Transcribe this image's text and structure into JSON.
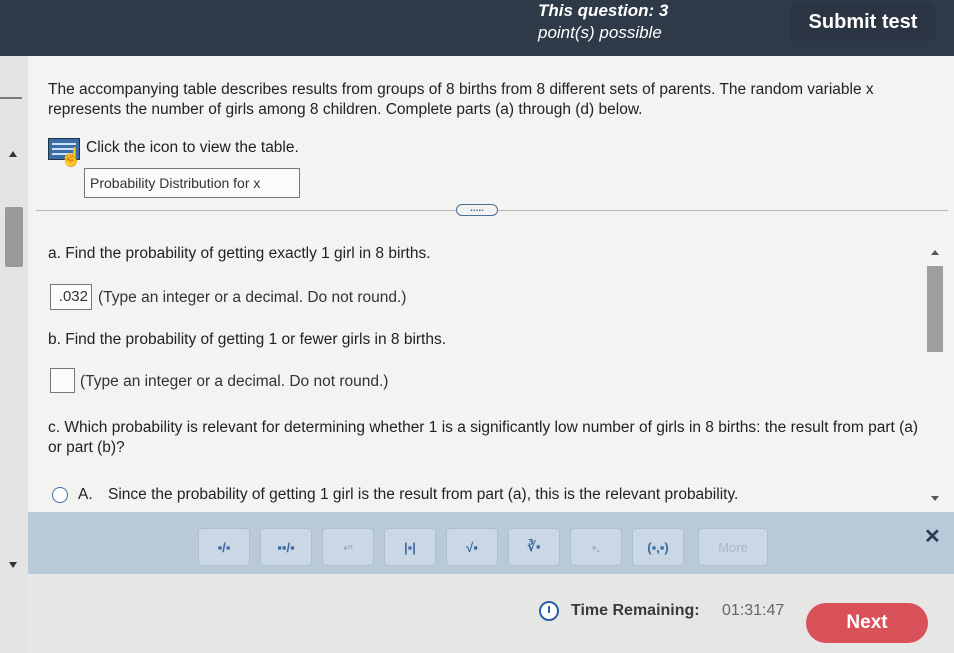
{
  "header": {
    "question_label": "This question: 3",
    "points_label": "point(s) possible",
    "submit_label": "Submit test"
  },
  "problem": {
    "intro": "The accompanying table describes results from groups of 8 births from 8 different sets of parents. The random variable x represents the number of girls among 8 children. Complete parts (a) through (d) below.",
    "click_text": "Click the icon to view the table.",
    "table_button_label": "Probability Distribution for x",
    "more_indicator": "....."
  },
  "part_a": {
    "question": "a. Find the probability of getting exactly 1 girl in 8 births.",
    "answer_value": ".032",
    "hint": "(Type an integer or a decimal. Do not round.)"
  },
  "part_b": {
    "question": "b. Find the probability of getting 1 or fewer girls in 8 births.",
    "answer_value": "",
    "hint": "(Type an integer or a decimal. Do not round.)"
  },
  "part_c": {
    "question": "c. Which probability is relevant for determining whether 1 is a significantly low number of girls in 8 births: the result from part (a) or part (b)?",
    "option_a_letter": "A.",
    "option_a_text": "Since the probability of getting 1 girl is the result from part (a), this is the relevant probability."
  },
  "toolbar": {
    "buttons": [
      "fraction",
      "mixed-number",
      "exponent",
      "absolute-value",
      "square-root",
      "nth-root",
      "subscript",
      "ordered-pair"
    ],
    "b0": "▪/▪",
    "b1": "▪▪/▪",
    "b2": "▪ⁿ",
    "b3": "|▪|",
    "b4": "√▪",
    "b5": "∛▪",
    "b6": "▪.",
    "b7": "(▪,▪)",
    "more_label": "More",
    "close_symbol": "✕"
  },
  "footer": {
    "time_label": "Time Remaining:",
    "time_value": "01:31:47",
    "next_label": "Next"
  },
  "colors": {
    "header_bg": "#2f3a48",
    "toolbar_bg": "#b9c9da",
    "next_bg": "#d9525a",
    "accent_blue": "#3b6ea8"
  }
}
